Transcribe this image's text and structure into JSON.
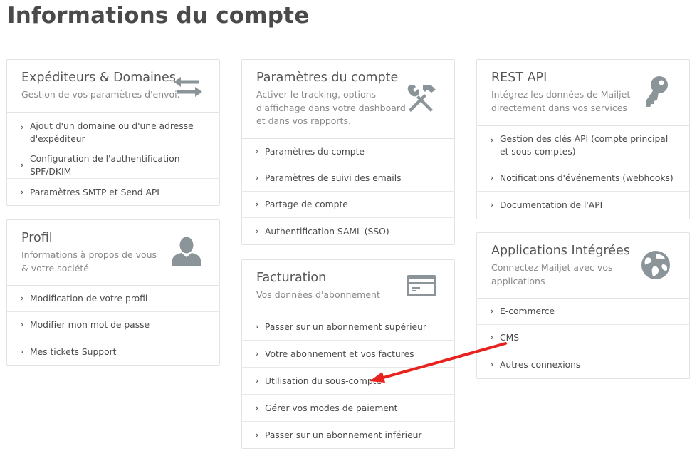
{
  "page": {
    "title": "Informations du compte"
  },
  "cards": {
    "senders": {
      "title": "Expéditeurs & Domaines",
      "desc": "Gestion de vos paramètres d'envoi.",
      "icon": "arrows-exchange-icon",
      "items": [
        "Ajout d'un domaine ou d'une adresse d'expéditeur",
        "Configuration de l'authentification SPF/DKIM",
        "Paramètres SMTP et Send API"
      ]
    },
    "profile": {
      "title": "Profil",
      "desc": "Informations à propos de vous & votre société",
      "icon": "user-icon",
      "items": [
        "Modification de votre profil",
        "Modifier mon mot de passe",
        "Mes tickets Support"
      ]
    },
    "account": {
      "title": "Paramètres du compte",
      "desc": "Activer le tracking, options d'affichage dans votre dashboard et dans vos rapports.",
      "icon": "tools-icon",
      "items": [
        "Paramètres du compte",
        "Paramètres de suivi des emails",
        "Partage de compte",
        "Authentification SAML (SSO)"
      ]
    },
    "billing": {
      "title": "Facturation",
      "desc": "Vos données d'abonnement",
      "icon": "credit-card-icon",
      "items": [
        "Passer sur un abonnement supérieur",
        "Votre abonnement et vos factures",
        "Utilisation du sous-compte",
        "Gérer vos modes de paiement",
        "Passer sur un abonnement inférieur"
      ]
    },
    "api": {
      "title": "REST API",
      "desc": "Intégrez les données de Mailjet directement dans vos services",
      "icon": "key-icon",
      "items": [
        "Gestion des clés API (compte principal et sous-comptes)",
        "Notifications d'événements (webhooks)",
        "Documentation de l'API"
      ]
    },
    "apps": {
      "title": "Applications Intégrées",
      "desc": "Connectez Mailjet avec vos applications",
      "icon": "globe-icon",
      "items": [
        "E-commerce",
        "CMS",
        "Autres connexions"
      ]
    }
  },
  "colors": {
    "annotation_arrow": "#e8231f",
    "icon": "#8a9499"
  }
}
